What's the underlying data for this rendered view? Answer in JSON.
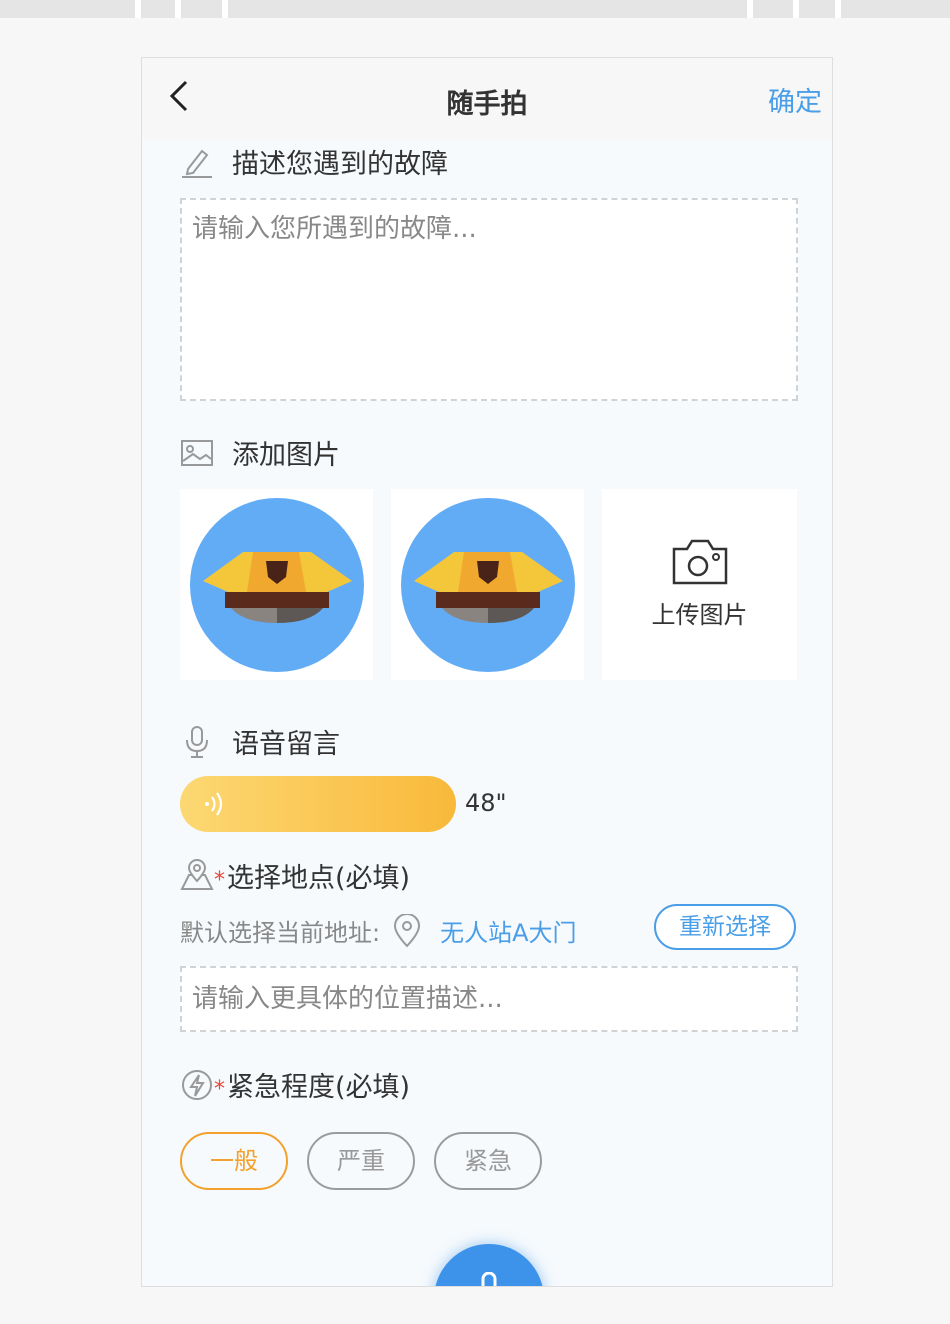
{
  "nav": {
    "title": "随手拍",
    "confirm_label": "确定"
  },
  "description": {
    "title": "描述您遇到的故障",
    "placeholder": "请输入您所遇到的故障..."
  },
  "photos": {
    "title": "添加图片",
    "items": [
      "police-cap-image",
      "police-cap-image"
    ],
    "upload_label": "上传图片"
  },
  "voice": {
    "title": "语音留言",
    "duration": "48\""
  },
  "location": {
    "title": "选择地点(必填)",
    "default_label": "默认选择当前地址:",
    "current_address": "无人站A大门",
    "reselect_label": "重新选择",
    "detail_placeholder": "请输入更具体的位置描述..."
  },
  "urgency": {
    "title": "紧急程度(必填)",
    "options": [
      "一般",
      "严重",
      "紧急"
    ],
    "selected": "一般"
  },
  "colors": {
    "accent": "#4a9ee8",
    "selected_urgency": "#f2a12c",
    "voice_bar": "#f9b93a",
    "required_star": "#e8483a"
  }
}
